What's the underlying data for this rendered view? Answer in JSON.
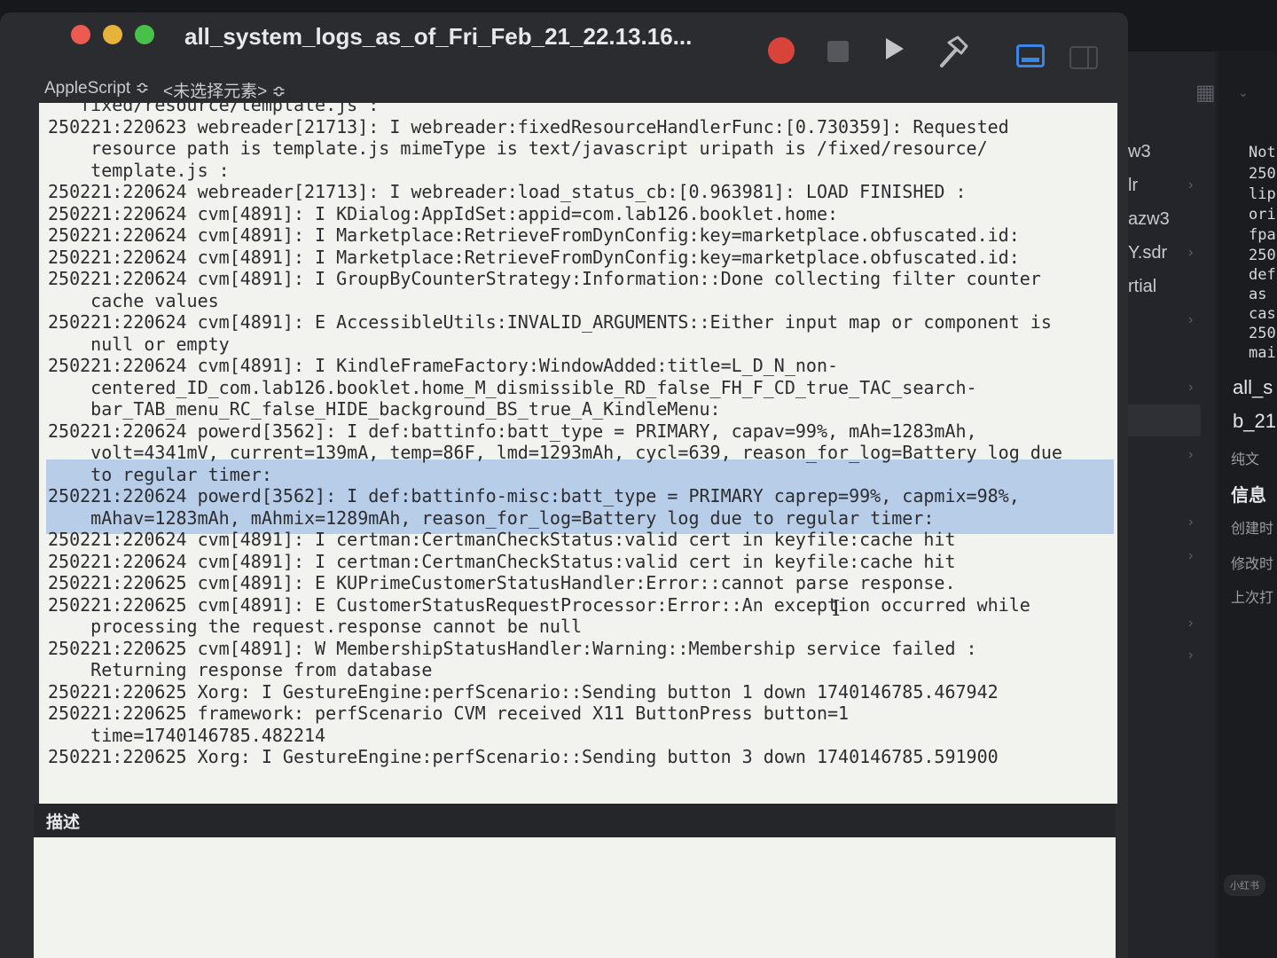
{
  "background_window": {
    "left_items": [
      "w3",
      "lr",
      "azw3",
      "Y.sdr",
      "rtial",
      "all_s",
      "b_21"
    ],
    "right_log_fragments": [
      "Not",
      "250",
      "lip",
      "ori",
      "fpa",
      "250",
      "def",
      "as",
      "cas",
      "250",
      "mai"
    ],
    "right_labels": [
      "纯文",
      "信息",
      "创建时",
      "修改时",
      "上次打"
    ],
    "watermark": "小红书"
  },
  "window": {
    "title": "all_system_logs_as_of_Fri_Feb_21_22.13.16...",
    "toolbar": {
      "record_icon": "record-icon",
      "stop_icon": "stop-icon",
      "run_icon": "play-icon",
      "compile_icon": "hammer-icon",
      "colors": {
        "record": "#d8433a",
        "active_toggle": "#3a86e8"
      }
    },
    "nav": {
      "language": "AppleScript ≎",
      "element": "<未选择元素> ≎"
    },
    "log_lines": [
      "   fixed/resource/template.js :",
      "250221:220623 webreader[21713]: I webreader:fixedResourceHandlerFunc:[0.730359]: Requested",
      "    resource path is template.js mimeType is text/javascript uripath is /fixed/resource/",
      "    template.js :",
      "250221:220624 webreader[21713]: I webreader:load_status_cb:[0.963981]: LOAD FINISHED :",
      "250221:220624 cvm[4891]: I KDialog:AppIdSet:appid=com.lab126.booklet.home:",
      "250221:220624 cvm[4891]: I Marketplace:RetrieveFromDynConfig:key=marketplace.obfuscated.id:",
      "250221:220624 cvm[4891]: I Marketplace:RetrieveFromDynConfig:key=marketplace.obfuscated.id:",
      "250221:220624 cvm[4891]: I GroupByCounterStrategy:Information::Done collecting filter counter",
      "    cache values",
      "250221:220624 cvm[4891]: E AccessibleUtils:INVALID_ARGUMENTS::Either input map or component is",
      "    null or empty",
      "250221:220624 cvm[4891]: I KindleFrameFactory:WindowAdded:title=L_D_N_non-",
      "    centered_ID_com.lab126.booklet.home_M_dismissible_RD_false_FH_F_CD_true_TAC_search-",
      "    bar_TAB_menu_RC_false_HIDE_background_BS_true_A_KindleMenu:",
      "250221:220624 powerd[3562]: I def:battinfo:batt_type = PRIMARY, capav=99%, mAh=1283mAh,",
      "    volt=4341mV, current=139mA, temp=86F, lmd=1293mAh, cycl=639, reason_for_log=Battery log due",
      "    to regular timer:",
      "250221:220624 powerd[3562]: I def:battinfo-misc:batt_type = PRIMARY caprep=99%, capmix=98%,",
      "    mAhav=1283mAh, mAhmix=1289mAh, reason_for_log=Battery log due to regular timer:",
      "250221:220624 cvm[4891]: I certman:CertmanCheckStatus:valid cert in keyfile:cache hit",
      "250221:220624 cvm[4891]: I certman:CertmanCheckStatus:valid cert in keyfile:cache hit",
      "250221:220625 cvm[4891]: E KUPrimeCustomerStatusHandler:Error::cannot parse response.",
      "250221:220625 cvm[4891]: E CustomerStatusRequestProcessor:Error::An exception occurred while",
      "    processing the request.response cannot be null",
      "250221:220625 cvm[4891]: W MembershipStatusHandler:Warning::Membership service failed :",
      "    Returning response from database",
      "250221:220625 Xorg: I GestureEngine:perfScenario::Sending button 1 down 1740146785.467942",
      "250221:220625 framework: perfScenario CVM received X11 ButtonPress button=1",
      "    time=1740146785.482214",
      "250221:220625 Xorg: I GestureEngine:perfScenario::Sending button 3 down 1740146785.591900"
    ],
    "description_label": "描述"
  }
}
